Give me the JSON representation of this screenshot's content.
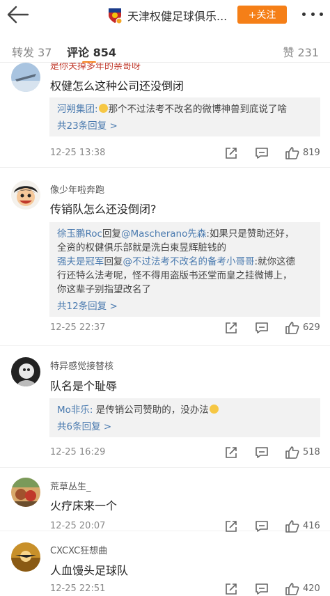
{
  "header": {
    "title": "天津权健足球俱乐...",
    "follow_label": "+关注"
  },
  "tabs": {
    "repost_label": "转发",
    "repost_count": "37",
    "comments_label": "评论",
    "comments_count": "854",
    "likes_label": "赞",
    "likes_count": "231"
  },
  "comments": [
    {
      "user": "是你关掉多年的亲哥呀",
      "text": "权健怎么这种公司还没倒闭",
      "replies": [
        {
          "name": "河朔集团:",
          "text": "那个不过法考不改名的微博神兽到底说了啥"
        }
      ],
      "more_replies": "共23条回复 >",
      "time": "12-25 13:38",
      "likes": "819"
    },
    {
      "user": "像少年啦奔跑",
      "text": "传销队怎么还没倒闭?",
      "replies": [
        {
          "name": "徐玉鹏Roc",
          "mid": "回复",
          "mention": "@Mascherano先森",
          "text": ":如果只是赞助还好，",
          "text2": "全资的权健俱乐部就是洗白束昱辉脏钱的"
        },
        {
          "name": "强夫是冠军",
          "mid": "回复",
          "mention": "@不过法考不改名的备考小哥哥",
          "text": ":就你这德",
          "text2": "行还特么法考呢，怪不得用盗版书还堂而皇之挂微博上，",
          "text3": "你这辈子别指望改名了"
        }
      ],
      "more_replies": "共12条回复 >",
      "time": "12-25 22:37",
      "likes": "629"
    },
    {
      "user": "特异感觉接替核",
      "text": "队名是个耻辱",
      "replies": [
        {
          "name": "Mo非乐:",
          "text": " 是传销公司赞助的，没办法"
        }
      ],
      "more_replies": "共6条回复 >",
      "time": "12-25 16:29",
      "likes": "518"
    },
    {
      "user": "荒草丛生_",
      "text": "火疗床来一个",
      "time": "12-25 20:07",
      "likes": "416"
    },
    {
      "user": "CXCXC狂想曲",
      "text": "人血馒头足球队",
      "time": "12-25 22:51",
      "likes": "420"
    }
  ],
  "colors": {
    "accent": "#f57f17",
    "link": "#4a7aaf",
    "reply_bg": "#f2f2f2"
  }
}
